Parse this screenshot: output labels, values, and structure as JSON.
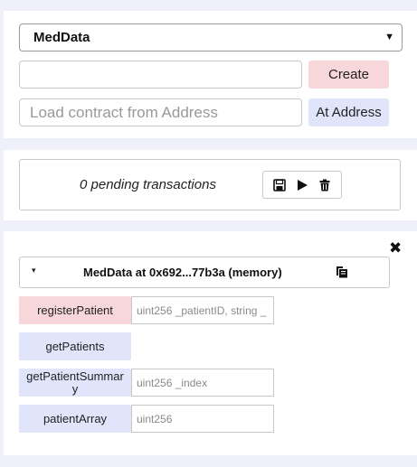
{
  "contract_select": {
    "selected": "MedData",
    "caret": "▼"
  },
  "create": {
    "arg_placeholder": "",
    "button_label": "Create"
  },
  "at_address": {
    "placeholder": "Load contract from Address",
    "button_label": "At Address"
  },
  "pending": {
    "text": "0 pending transactions",
    "icons": [
      "save-icon",
      "play-icon",
      "trash-icon"
    ]
  },
  "instance": {
    "toggle": "▾",
    "title": "MedData at 0x692...77b3a (memory)",
    "close": "✖",
    "functions": [
      {
        "name": "registerPatient",
        "placeholder": "uint256 _patientID, string _",
        "color": "red"
      },
      {
        "name": "getPatients",
        "placeholder": null,
        "color": "blue"
      },
      {
        "name": "getPatientSummar\ny",
        "placeholder": "uint256 _index",
        "color": "blue"
      },
      {
        "name": "patientArray",
        "placeholder": "uint256",
        "color": "blue"
      }
    ]
  },
  "colors": {
    "background": "#f0f0fa",
    "red_button": "#f8d7da",
    "blue_button": "#e0e5fb"
  }
}
